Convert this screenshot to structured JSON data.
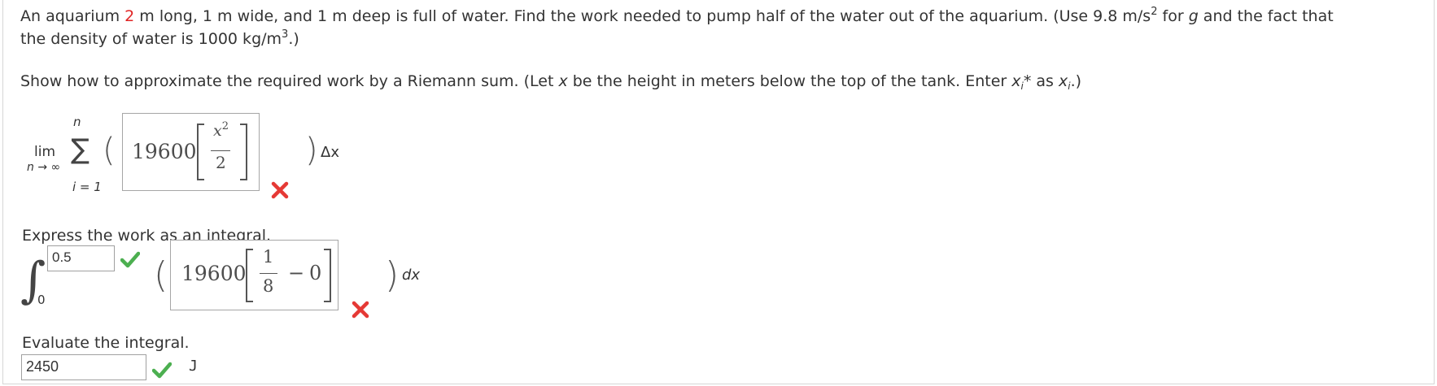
{
  "problem": {
    "p1_a": "An aquarium ",
    "length_value": "2",
    "p1_b": " m long, 1 m wide, and 1 m deep is full of water. Find the work needed to pump half of the water out of the aquarium. (Use 9.8 m/s",
    "p1_sup": "2",
    "p1_c": " for ",
    "p1_g": "g",
    "p1_d": " and the fact that",
    "p2_a": "the density of water is 1000 kg/m",
    "p2_sup": "3",
    "p2_b": ".)"
  },
  "riemann": {
    "q_a": "Show how to approximate the required work by a Riemann sum. (Let ",
    "q_x": "x",
    "q_b": " be the height in meters below the top of the tank. Enter ",
    "q_xi": "x",
    "q_i": "i",
    "q_star": "*",
    "q_c": " as ",
    "q_xi2": "x",
    "q_i2": "i",
    "q_d": ".)",
    "upper": "n",
    "lim": "lim",
    "lim_sub": "n → ∞",
    "sigma": "∑",
    "lower": "i = 1",
    "answer_coef": "19600",
    "answer_num": "x",
    "answer_num_sup": "2",
    "answer_den": "2",
    "delta": "Δx",
    "status_icon": "cross-icon",
    "status_color": "#e53935"
  },
  "integral": {
    "label": "Express the work as an integral.",
    "upper_limit": "0.5",
    "upper_status": "check-icon",
    "lower_limit": "0",
    "integral_sign": "∫",
    "answer_coef": "19600",
    "answer_num": "1",
    "answer_den": "8",
    "answer_minus": "−",
    "answer_zero": "0",
    "dx": "dx",
    "status_icon": "cross-icon"
  },
  "evaluate": {
    "label": "Evaluate the integral.",
    "value": "2450",
    "unit": "J",
    "status_icon": "check-icon",
    "check_color": "#4caf50"
  }
}
